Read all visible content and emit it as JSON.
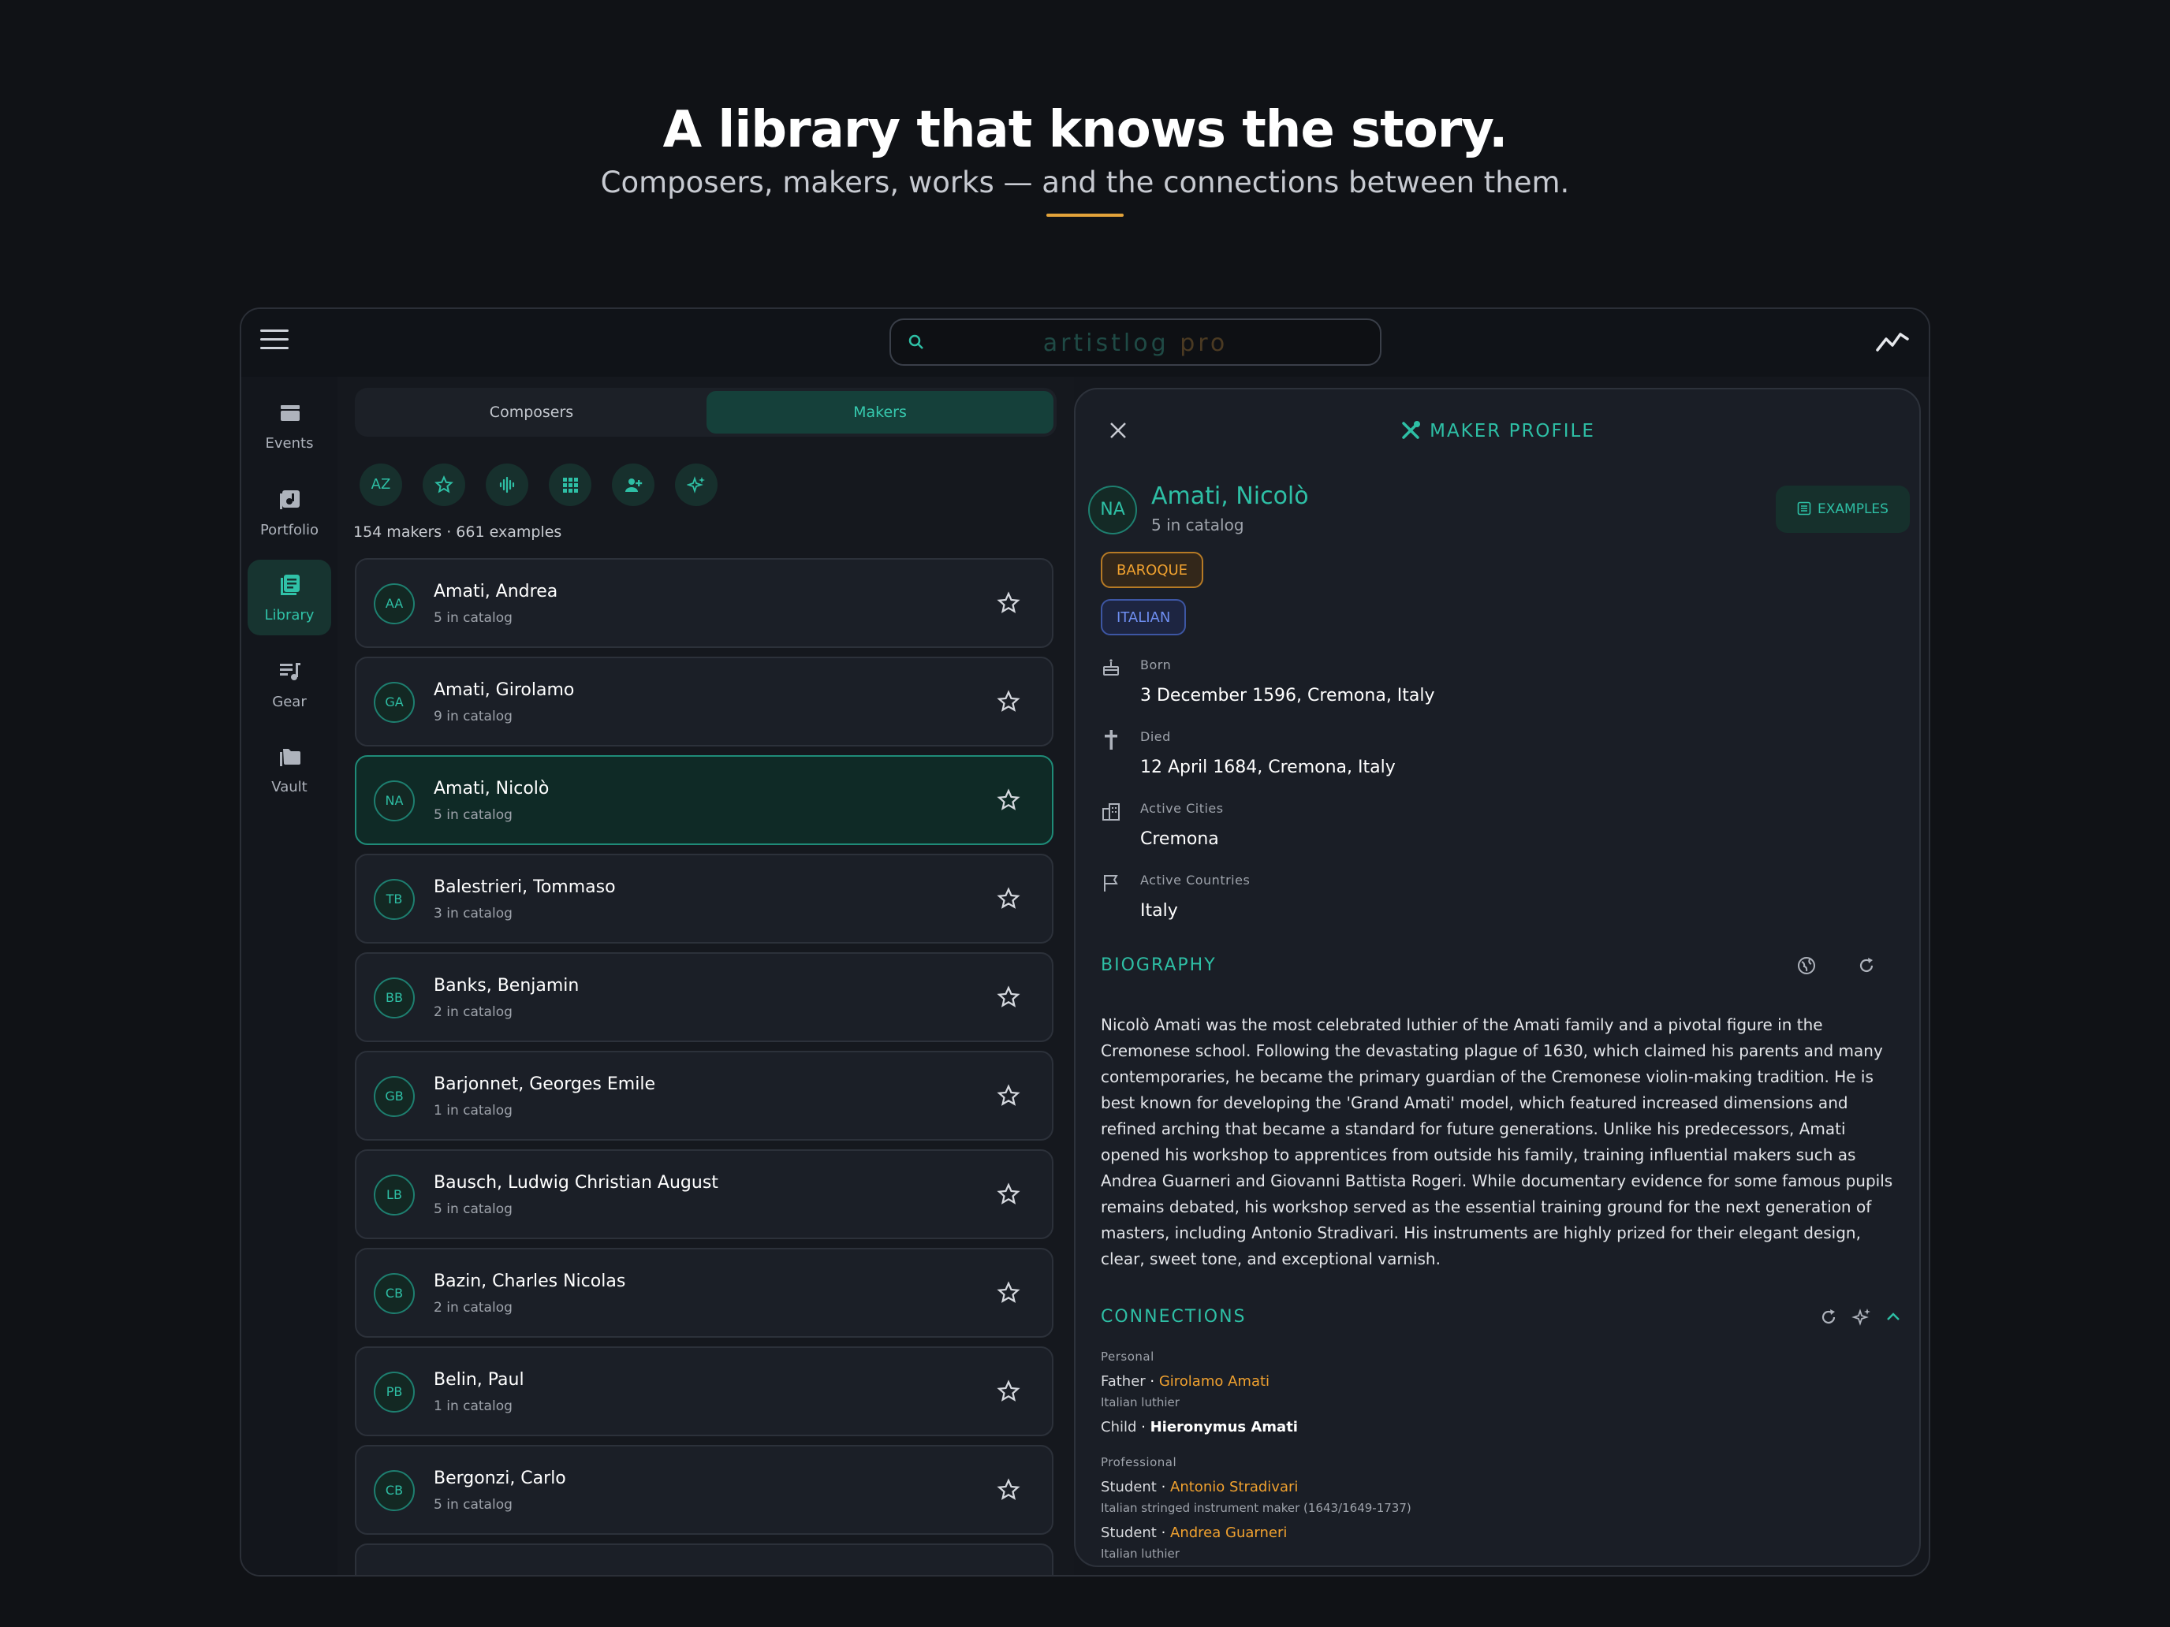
{
  "hero": {
    "title": "A library that knows the story.",
    "subtitle": "Composers, makers, works — and the connections between them."
  },
  "app": {
    "brand_main": "artistlog",
    "brand_pro": "pro"
  },
  "rail": {
    "items": [
      {
        "label": "Events",
        "icon": "events-icon"
      },
      {
        "label": "Portfolio",
        "icon": "portfolio-icon"
      },
      {
        "label": "Library",
        "icon": "library-icon",
        "active": true
      },
      {
        "label": "Gear",
        "icon": "gear-icon"
      },
      {
        "label": "Vault",
        "icon": "vault-icon"
      }
    ]
  },
  "segment": {
    "left": "Composers",
    "right": "Makers",
    "selected": "Makers"
  },
  "filters": [
    {
      "icon": "sort-az-icon",
      "text": "AZ"
    },
    {
      "icon": "star-icon"
    },
    {
      "icon": "waveform-icon"
    },
    {
      "icon": "grid-icon"
    },
    {
      "icon": "person-add-icon"
    },
    {
      "icon": "sparkle-icon"
    }
  ],
  "summary": "154 makers · 661 examples",
  "makers": [
    {
      "initials": "AA",
      "name": "Amati, Andrea",
      "catalog": "5 in catalog"
    },
    {
      "initials": "GA",
      "name": "Amati, Girolamo",
      "catalog": "9 in catalog"
    },
    {
      "initials": "NA",
      "name": "Amati, Nicolò",
      "catalog": "5 in catalog",
      "selected": true
    },
    {
      "initials": "TB",
      "name": "Balestrieri, Tommaso",
      "catalog": "3 in catalog"
    },
    {
      "initials": "BB",
      "name": "Banks, Benjamin",
      "catalog": "2 in catalog"
    },
    {
      "initials": "GB",
      "name": "Barjonnet, Georges Emile",
      "catalog": "1 in catalog"
    },
    {
      "initials": "LB",
      "name": "Bausch, Ludwig Christian August",
      "catalog": "5 in catalog"
    },
    {
      "initials": "CB",
      "name": "Bazin, Charles Nicolas",
      "catalog": "2 in catalog"
    },
    {
      "initials": "PB",
      "name": "Belin, Paul",
      "catalog": "1 in catalog"
    },
    {
      "initials": "CB",
      "name": "Bergonzi, Carlo",
      "catalog": "5 in catalog"
    }
  ],
  "profile": {
    "header": "MAKER PROFILE",
    "initials": "NA",
    "name": "Amati, Nicolò",
    "catalog": "5 in catalog",
    "examples_label": "EXAMPLES",
    "tags": [
      "BAROQUE",
      "ITALIAN"
    ],
    "facts": [
      {
        "label": "Born",
        "value": "3 December 1596, Cremona, Italy",
        "icon": "cake-icon"
      },
      {
        "label": "Died",
        "value": "12 April 1684, Cremona, Italy",
        "icon": "cross-icon"
      },
      {
        "label": "Active Cities",
        "value": "Cremona",
        "icon": "city-icon"
      },
      {
        "label": "Active Countries",
        "value": "Italy",
        "icon": "flag-icon"
      }
    ],
    "biography_heading": "BIOGRAPHY",
    "biography": "Nicolò Amati was the most celebrated luthier of the Amati family and a pivotal figure in the Cremonese school. Following the devastating plague of 1630, which claimed his parents and many contemporaries, he became the primary guardian of the Cremonese violin-making tradition. He is best known for developing the 'Grand Amati' model, which featured increased dimensions and refined arching that became a standard for future generations. Unlike his predecessors, Amati opened his workshop to apprentices from outside his family, training influential makers such as Andrea Guarneri and Giovanni Battista Rogeri. While documentary evidence for some famous pupils remains debated, his workshop served as the essential training ground for the next generation of masters, including Antonio Stradivari. His instruments are highly prized for their elegant design, clear, sweet tone, and exceptional varnish.",
    "connections_heading": "CONNECTIONS",
    "personal_label": "Personal",
    "professional_label": "Professional",
    "connections": {
      "father_rel": "Father",
      "father_name": "Girolamo Amati",
      "father_desc": "Italian luthier",
      "child_rel": "Child",
      "child_name": "Hieronymus Amati",
      "student1_rel": "Student",
      "student1_name": "Antonio Stradivari",
      "student1_desc": "Italian stringed instrument maker (1643/1649-1737)",
      "student2_rel": "Student",
      "student2_name": "Andrea Guarneri",
      "student2_desc": "Italian luthier"
    }
  }
}
